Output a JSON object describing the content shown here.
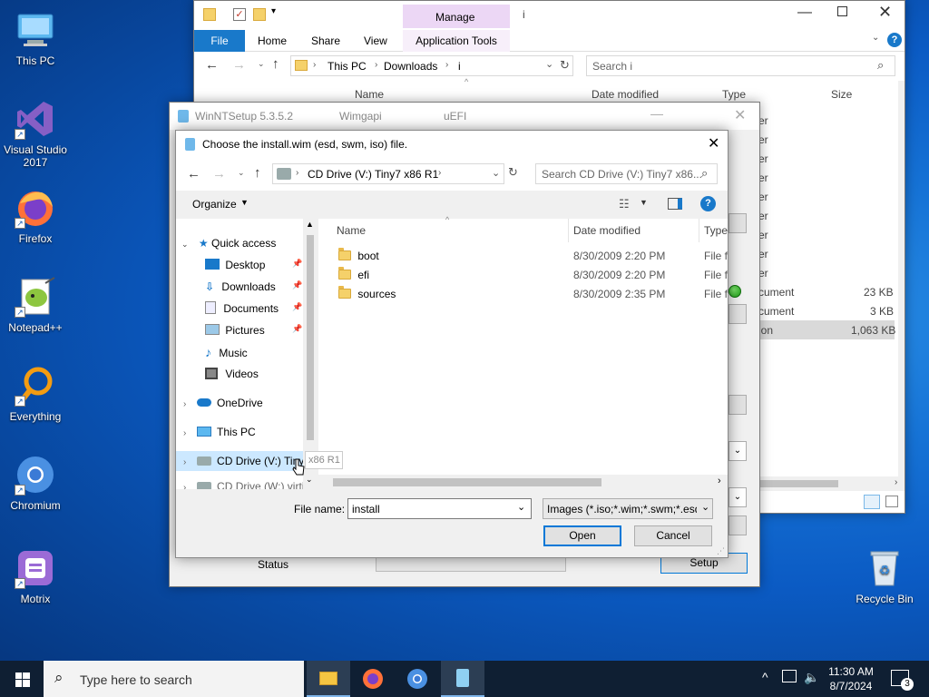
{
  "colors": {
    "accent": "#0078d7",
    "manage_tab": "#ecd7f5",
    "taskbar": "#0f1f33",
    "selection": "#cce8ff"
  },
  "desktop": {
    "icons": [
      {
        "label": "This PC",
        "icon": "this-pc-icon"
      },
      {
        "label": "Visual Studio 2017",
        "icon": "visual-studio-icon"
      },
      {
        "label": "Firefox",
        "icon": "firefox-icon"
      },
      {
        "label": "Notepad++",
        "icon": "notepadpp-icon"
      },
      {
        "label": "Everything",
        "icon": "everything-icon"
      },
      {
        "label": "Chromium",
        "icon": "chromium-icon"
      },
      {
        "label": "Motrix",
        "icon": "motrix-icon"
      },
      {
        "label": "Recycle Bin",
        "icon": "recycle-bin-icon"
      }
    ]
  },
  "explorer": {
    "title": "i",
    "manage_label": "Manage",
    "tabs": [
      "File",
      "Home",
      "Share",
      "View",
      "Application Tools"
    ],
    "address": {
      "segments": [
        "This PC",
        "Downloads",
        "i"
      ]
    },
    "search_placeholder": "Search i",
    "columns": [
      "Name",
      "Date modified",
      "Type",
      "Size"
    ],
    "rows": [
      {
        "type": "er",
        "size": ""
      },
      {
        "type": "er",
        "size": ""
      },
      {
        "type": "er",
        "size": ""
      },
      {
        "type": "er",
        "size": ""
      },
      {
        "type": "er",
        "size": ""
      },
      {
        "type": "er",
        "size": ""
      },
      {
        "type": "er",
        "size": ""
      },
      {
        "type": "er",
        "size": ""
      },
      {
        "type": "er",
        "size": ""
      },
      {
        "type": "cument",
        "size": "23 KB"
      },
      {
        "type": "cument",
        "size": "3 KB"
      },
      {
        "type": "ion",
        "size": "1,063 KB"
      }
    ]
  },
  "winntsetup": {
    "title": "WinNTSetup 5.3.5.2",
    "wimgapi": "Wimgapi",
    "uefi": "uEFI",
    "status_label": "Status",
    "setup_label": "Setup"
  },
  "dialog": {
    "title": "Choose the install.wim (esd, swm, iso) file.",
    "address_segment": "CD Drive (V:) Tiny7 x86 R1",
    "search_placeholder": "Search CD Drive (V:) Tiny7 x86...",
    "organize_label": "Organize",
    "nav": {
      "quick_access": "Quick access",
      "quick_items": [
        "Desktop",
        "Downloads",
        "Documents",
        "Pictures",
        "Music",
        "Videos"
      ],
      "onedrive": "OneDrive",
      "this_pc": "This PC",
      "cd_drive": "CD Drive (V:) Tiny7",
      "cd_drive_tooltip": "x86 R1",
      "cd_drive_w": "CD Drive (W:) virti"
    },
    "columns": {
      "name": "Name",
      "date": "Date modified",
      "type": "Type"
    },
    "files": [
      {
        "name": "boot",
        "date": "8/30/2009 2:20 PM",
        "type": "File fo"
      },
      {
        "name": "efi",
        "date": "8/30/2009 2:20 PM",
        "type": "File fo"
      },
      {
        "name": "sources",
        "date": "8/30/2009 2:35 PM",
        "type": "File fo"
      }
    ],
    "filename_label": "File name:",
    "filename_value": "install",
    "filter_value": "Images (*.iso;*.wim;*.swm;*.esd)",
    "open_label": "Open",
    "cancel_label": "Cancel"
  },
  "taskbar": {
    "search_placeholder": "Type here to search",
    "time": "11:30 AM",
    "date": "8/7/2024",
    "notifications": "3"
  }
}
